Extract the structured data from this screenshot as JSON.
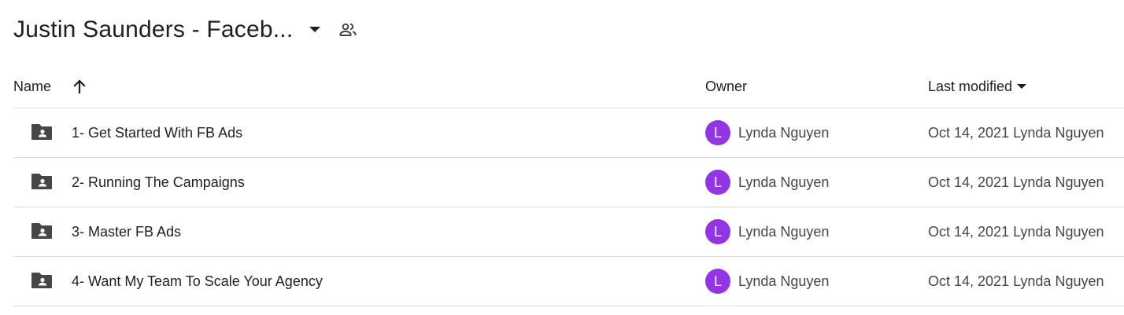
{
  "folder": {
    "title": "Justin Saunders - Faceb..."
  },
  "columns": {
    "name": "Name",
    "owner": "Owner",
    "last_modified": "Last modified"
  },
  "rows": [
    {
      "name": "1- Get Started With FB Ads",
      "owner_initial": "L",
      "owner": "Lynda Nguyen",
      "modified": "Oct 14, 2021 Lynda Nguyen"
    },
    {
      "name": "2- Running The Campaigns",
      "owner_initial": "L",
      "owner": "Lynda Nguyen",
      "modified": "Oct 14, 2021 Lynda Nguyen"
    },
    {
      "name": "3- Master FB Ads",
      "owner_initial": "L",
      "owner": "Lynda Nguyen",
      "modified": "Oct 14, 2021 Lynda Nguyen"
    },
    {
      "name": "4- Want My Team To Scale Your Agency",
      "owner_initial": "L",
      "owner": "Lynda Nguyen",
      "modified": "Oct 14, 2021 Lynda Nguyen"
    }
  ],
  "icons": {
    "title_menu": "arrow-drop-down-icon",
    "shared": "people-outline-icon",
    "sort": "arrow-upward-icon",
    "sort_field": "arrow-drop-down-icon",
    "row": "shared-folder-icon"
  },
  "colors": {
    "avatar": "#9334e6",
    "folder": "#444746",
    "divider": "#dadce0"
  }
}
